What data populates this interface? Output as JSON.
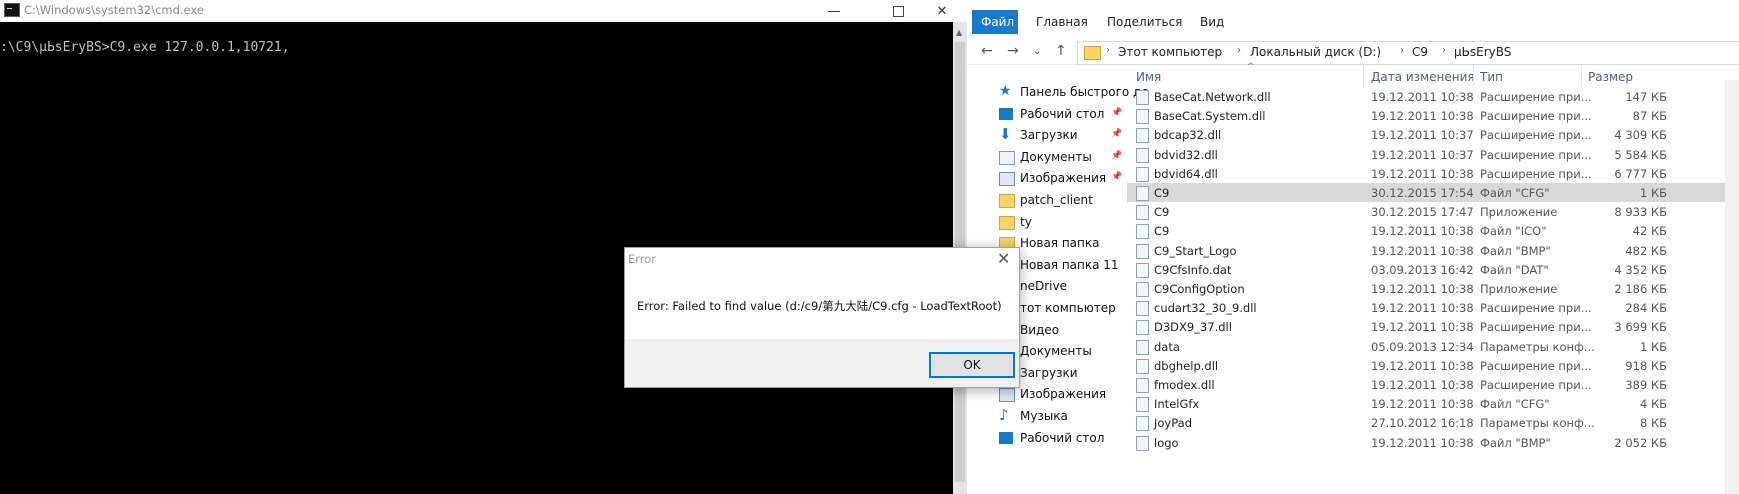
{
  "cmd": {
    "title": "C:\\Windows\\system32\\cmd.exe",
    "line": ":\\C9\\µЬsЕrуBS>C9.exe 127.0.0.1,10721,",
    "min": "—",
    "close": "✕"
  },
  "explorer": {
    "ribbon": {
      "file": "Файл",
      "home": "Главная",
      "share": "Поделиться",
      "view": "Вид"
    },
    "nav": {
      "back": "←",
      "fwd": "→",
      "recent": "⌄",
      "up": "↑"
    },
    "address": {
      "pc": "Этот компьютер",
      "disk": "Локальный диск (D:)",
      "c9": "C9",
      "folder": "µЬsЕrуBS"
    },
    "nav_pane": [
      {
        "label": "Панель быстрого дс",
        "icon": "star-icon",
        "pin": false
      },
      {
        "label": "Рабочий стол",
        "icon": "desktop-icon",
        "pin": true
      },
      {
        "label": "Загрузки",
        "icon": "download-icon",
        "pin": true
      },
      {
        "label": "Документы",
        "icon": "documents-icon",
        "pin": true
      },
      {
        "label": "Изображения",
        "icon": "pictures-icon",
        "pin": true
      },
      {
        "label": "patch_client",
        "icon": "folder-icon",
        "pin": false
      },
      {
        "label": "ty",
        "icon": "folder-icon",
        "pin": false
      },
      {
        "label": "Новая папка",
        "icon": "folder-icon",
        "pin": false
      },
      {
        "label": "Новая папка 11",
        "icon": "folder-icon",
        "pin": false
      },
      {
        "label": "neDrive",
        "icon": "onedrive-icon",
        "pin": false
      },
      {
        "label": "тот компьютер",
        "icon": "computer-icon",
        "pin": false
      },
      {
        "label": "Видео",
        "icon": "video-icon",
        "pin": false
      },
      {
        "label": "Документы",
        "icon": "documents-icon",
        "pin": false
      },
      {
        "label": "Загрузки",
        "icon": "download-icon",
        "pin": false
      },
      {
        "label": "Изображения",
        "icon": "pictures-icon",
        "pin": false
      },
      {
        "label": "Музыка",
        "icon": "music-icon",
        "pin": false
      },
      {
        "label": "Рабочий стол",
        "icon": "desktop-icon",
        "pin": false
      }
    ],
    "columns": {
      "name": "Имя",
      "date": "Дата изменения",
      "type": "Тип",
      "size": "Размер"
    },
    "files": [
      {
        "name": "BaseCat.Network.dll",
        "date": "19.12.2011 10:38",
        "type": "Расширение при...",
        "size": "147 КБ"
      },
      {
        "name": "BaseCat.System.dll",
        "date": "19.12.2011 10:38",
        "type": "Расширение при...",
        "size": "87 КБ"
      },
      {
        "name": "bdcap32.dll",
        "date": "19.12.2011 10:37",
        "type": "Расширение при...",
        "size": "4 309 КБ"
      },
      {
        "name": "bdvid32.dll",
        "date": "19.12.2011 10:37",
        "type": "Расширение при...",
        "size": "5 584 КБ"
      },
      {
        "name": "bdvid64.dll",
        "date": "19.12.2011 10:38",
        "type": "Расширение при...",
        "size": "6 777 КБ"
      },
      {
        "name": "C9",
        "date": "30.12.2015 17:54",
        "type": "Файл \"CFG\"",
        "size": "1 КБ"
      },
      {
        "name": "C9",
        "date": "30.12.2015 17:47",
        "type": "Приложение",
        "size": "8 933 КБ"
      },
      {
        "name": "C9",
        "date": "19.12.2011 10:38",
        "type": "Файл \"ICO\"",
        "size": "42 КБ"
      },
      {
        "name": "C9_Start_Logo",
        "date": "19.12.2011 10:38",
        "type": "Файл \"BMP\"",
        "size": "482 КБ"
      },
      {
        "name": "C9CfsInfo.dat",
        "date": "03.09.2013 16:42",
        "type": "Файл \"DAT\"",
        "size": "4 352 КБ"
      },
      {
        "name": "C9ConfigOption",
        "date": "19.12.2011 10:38",
        "type": "Приложение",
        "size": "2 186 КБ"
      },
      {
        "name": "cudart32_30_9.dll",
        "date": "19.12.2011 10:38",
        "type": "Расширение при...",
        "size": "284 КБ"
      },
      {
        "name": "D3DX9_37.dll",
        "date": "19.12.2011 10:38",
        "type": "Расширение при...",
        "size": "3 699 КБ"
      },
      {
        "name": "data",
        "date": "05.09.2013 12:34",
        "type": "Параметры конф...",
        "size": "1 КБ"
      },
      {
        "name": "dbghelp.dll",
        "date": "19.12.2011 10:38",
        "type": "Расширение при...",
        "size": "918 КБ"
      },
      {
        "name": "fmodex.dll",
        "date": "19.12.2011 10:38",
        "type": "Расширение при...",
        "size": "389 КБ"
      },
      {
        "name": "IntelGfx",
        "date": "19.12.2011 10:38",
        "type": "Файл \"CFG\"",
        "size": "4 КБ"
      },
      {
        "name": "JoyPad",
        "date": "27.10.2012 16:18",
        "type": "Параметры конф...",
        "size": "8 КБ"
      },
      {
        "name": "logo",
        "date": "19.12.2011 10:38",
        "type": "Файл \"BMP\"",
        "size": "2 052 КБ"
      }
    ],
    "selected_index": 5
  },
  "dialog": {
    "title": "Error",
    "message": "Error: Failed to find value (d:/c9/第九大陆/C9.cfg - LoadTextRoot)",
    "ok": "OK",
    "close": "✕"
  },
  "colors": {
    "accent": "#1979ca",
    "selection": "#d9d9d9"
  }
}
